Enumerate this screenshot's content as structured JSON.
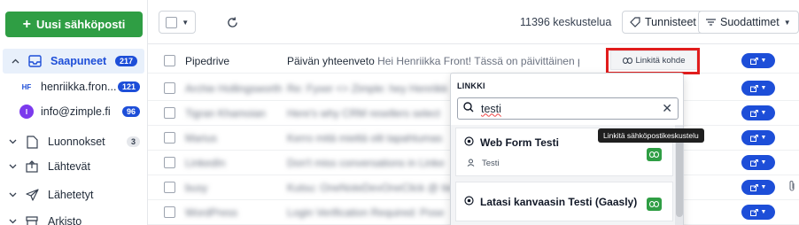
{
  "sidebar": {
    "new_button_label": "Uusi sähköposti",
    "inbox": {
      "label": "Saapuneet",
      "count": "217"
    },
    "accounts": [
      {
        "avatar": "HF",
        "label": "henriikka.fron...",
        "count": "121"
      },
      {
        "avatar": "I",
        "label": "info@zimple.fi",
        "count": "96"
      }
    ],
    "folders": [
      {
        "label": "Luonnokset",
        "count": "3"
      },
      {
        "label": "Lähtevät"
      },
      {
        "label": "Lähetetyt"
      },
      {
        "label": "Arkisto"
      }
    ]
  },
  "toolbar": {
    "conversation_count": "11396 keskustelua",
    "tags_label": "Tunnisteet",
    "filters_label": "Suodattimet"
  },
  "mails": [
    {
      "sender": "Pipedrive",
      "subject": "Päivän yhteenveto",
      "preview": "Hei Henriikka Front! Tässä on päivittäinen päivi...",
      "attachment": false
    },
    {
      "sender": "Archie Hollingsworth",
      "subject": "Re: Fyxer <> Zimple: hey Henriikk",
      "preview": "",
      "attachment": false
    },
    {
      "sender": "Tigran Khamoian",
      "subject": "Here's why CRM resellers select",
      "preview": "",
      "attachment": false
    },
    {
      "sender": "Marius",
      "subject": "Kerro mitä mieltä olit tapahtumas",
      "preview": "",
      "attachment": false
    },
    {
      "sender": "LinkedIn",
      "subject": "Don't miss conversations in Linke",
      "preview": "",
      "attachment": false
    },
    {
      "sender": "busy",
      "subject": "Kutsu: OneNoteDevOneClick @ tie",
      "preview": "",
      "attachment": true
    },
    {
      "sender": "WordPress",
      "subject": "Login Verification Required: Pose",
      "preview": "",
      "attachment": false
    }
  ],
  "link_tag_label": "Linkitä kohde",
  "link_dropdown": {
    "title": "LINKKI",
    "search_value": "testi",
    "items": [
      {
        "name": "Web Form Testi",
        "owner": "Testi"
      },
      {
        "name": "Latasi kanvaasin Testi (Gaasly)"
      }
    ]
  },
  "tooltip": "Linkitä sähköpostikeskustelu",
  "colors": {
    "primary_green": "#2f9e44",
    "accent_blue": "#1d4ed8",
    "highlight_red": "#e11d1d"
  }
}
